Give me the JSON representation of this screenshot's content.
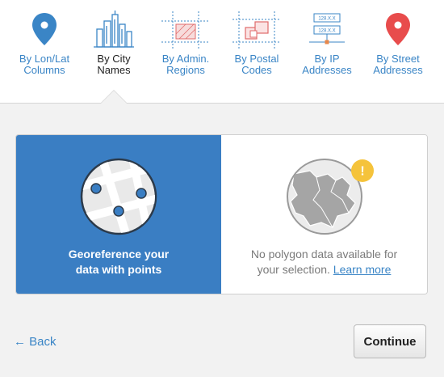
{
  "tabs": [
    {
      "label": "By Lon/Lat Columns",
      "line1": "By Lon/Lat",
      "line2": "Columns",
      "icon": "map-pin-icon",
      "active": false
    },
    {
      "label": "By City Names",
      "line1": "By City",
      "line2": "Names",
      "icon": "city-skyline-icon",
      "active": true
    },
    {
      "label": "By Admin. Regions",
      "line1": "By Admin.",
      "line2": "Regions",
      "icon": "admin-regions-icon",
      "active": false
    },
    {
      "label": "By Postal Codes",
      "line1": "By Postal",
      "line2": "Codes",
      "icon": "postal-codes-icon",
      "active": false
    },
    {
      "label": "By IP Addresses",
      "line1": "By IP",
      "line2": "Addresses",
      "icon": "ip-address-icon",
      "ip_chip": "128.X.X",
      "active": false
    },
    {
      "label": "By Street Addresses",
      "line1": "By Street",
      "line2": "Addresses",
      "icon": "street-pin-icon",
      "active": false
    }
  ],
  "options": {
    "points": {
      "line1": "Georeference your",
      "line2": "data with points",
      "icon": "map-points-icon"
    },
    "polygon": {
      "line1": "No polygon data available for",
      "line2_prefix": "your selection. ",
      "link": "Learn more",
      "icon": "globe-icon",
      "warning_icon": "warning-icon",
      "warning_glyph": "!"
    }
  },
  "footer": {
    "back_arrow": "←",
    "back_label": "Back",
    "continue_label": "Continue"
  },
  "colors": {
    "accent": "#3a85c6",
    "selected_option": "#3a7ec3",
    "pin_red": "#e84c4c",
    "warning": "#f5c33b"
  }
}
